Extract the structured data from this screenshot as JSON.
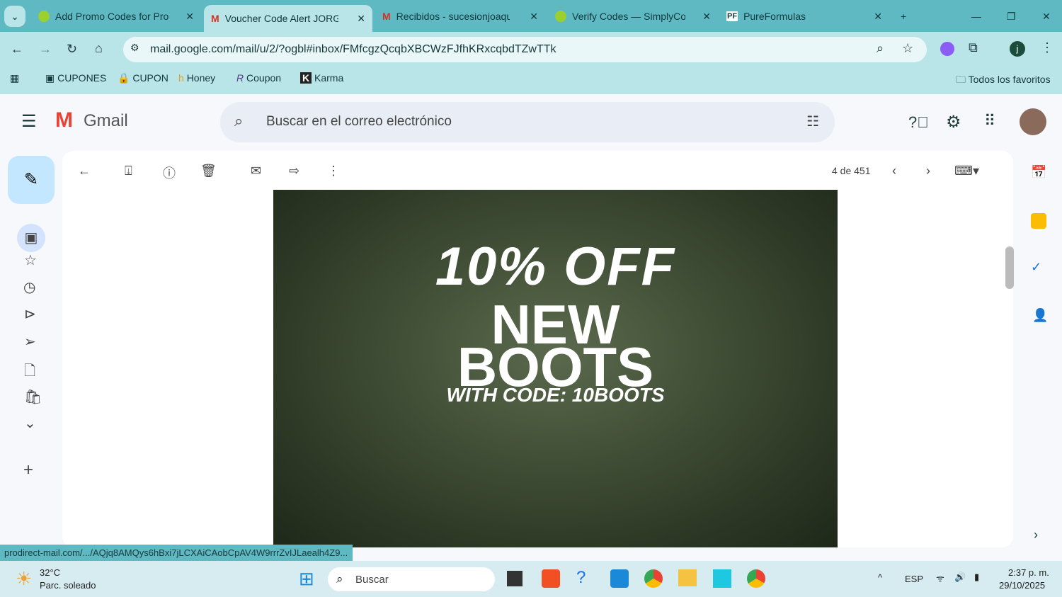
{
  "tabs": [
    {
      "label": "Add Promo Codes for Pro:Direct"
    },
    {
      "label": "Voucher Code Alert JORGE",
      "active": true
    },
    {
      "label": "Recibidos - sucesionjoaquin"
    },
    {
      "label": "Verify Codes — SimplyCodes"
    },
    {
      "label": "PureFormulas"
    }
  ],
  "url": "mail.google.com/mail/u/2/?ogbl#inbox/FMfcgzQcqbXBCWzFJfhKRxcqbdTZwTTk",
  "bookmarks": [
    "CUPONES",
    "CUPON",
    "Honey",
    "Coupon",
    "Karma"
  ],
  "all_bookmarks": "Todos los favoritos",
  "gmail": {
    "logo": "Gmail",
    "search_placeholder": "Buscar en el correo electrónico",
    "counter": "4 de 451"
  },
  "promo": {
    "line1": "10% OFF",
    "line2": "NEW",
    "line3": "BOOTS",
    "line4": "WITH CODE: 10BOOTS"
  },
  "status_url": "prodirect-mail.com/.../AQjq8AMQys6hBxi7jLCXAiCAobCpAV4W9rrrZvIJLaealh4Z9...",
  "taskbar": {
    "temp": "32°C",
    "weather": "Parc. soleado",
    "search": "Buscar",
    "lang": "ESP",
    "time": "2:37 p. m.",
    "date": "29/10/2025"
  },
  "colors": {
    "chrome": "#5fb9c2",
    "toolbar": "#b9e4e8"
  }
}
